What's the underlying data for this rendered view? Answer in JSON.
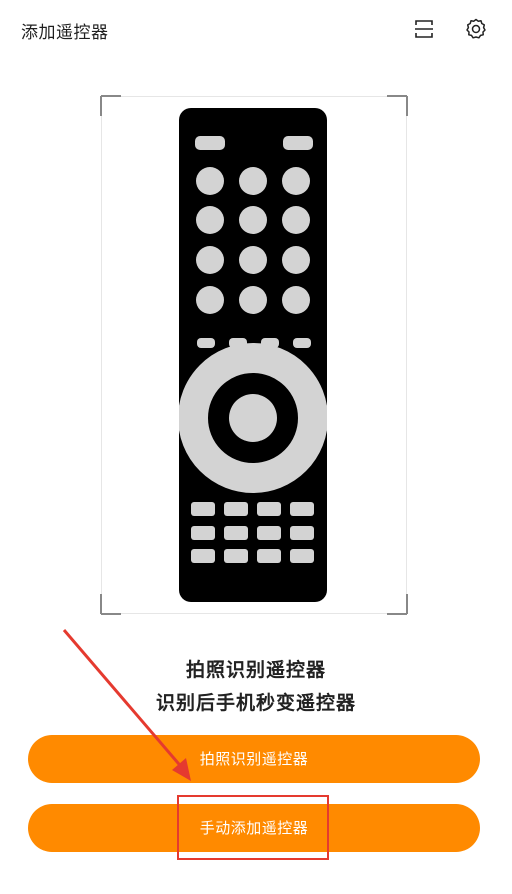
{
  "header": {
    "title": "添加遥控器",
    "scan_icon": "scan-icon",
    "settings_icon": "gear-icon"
  },
  "illustration": {
    "name": "remote-control-illustration",
    "remote_color": "#000000",
    "button_color": "#d3d3d3"
  },
  "description": {
    "line1": "拍照识别遥控器",
    "line2": "识别后手机秒变遥控器"
  },
  "buttons": {
    "photo_label": "拍照识别遥控器",
    "manual_label": "手动添加遥控器",
    "color": "#ff8a00"
  },
  "annotation": {
    "arrow_color": "#e53a2f",
    "box_color": "#e53a2f"
  }
}
